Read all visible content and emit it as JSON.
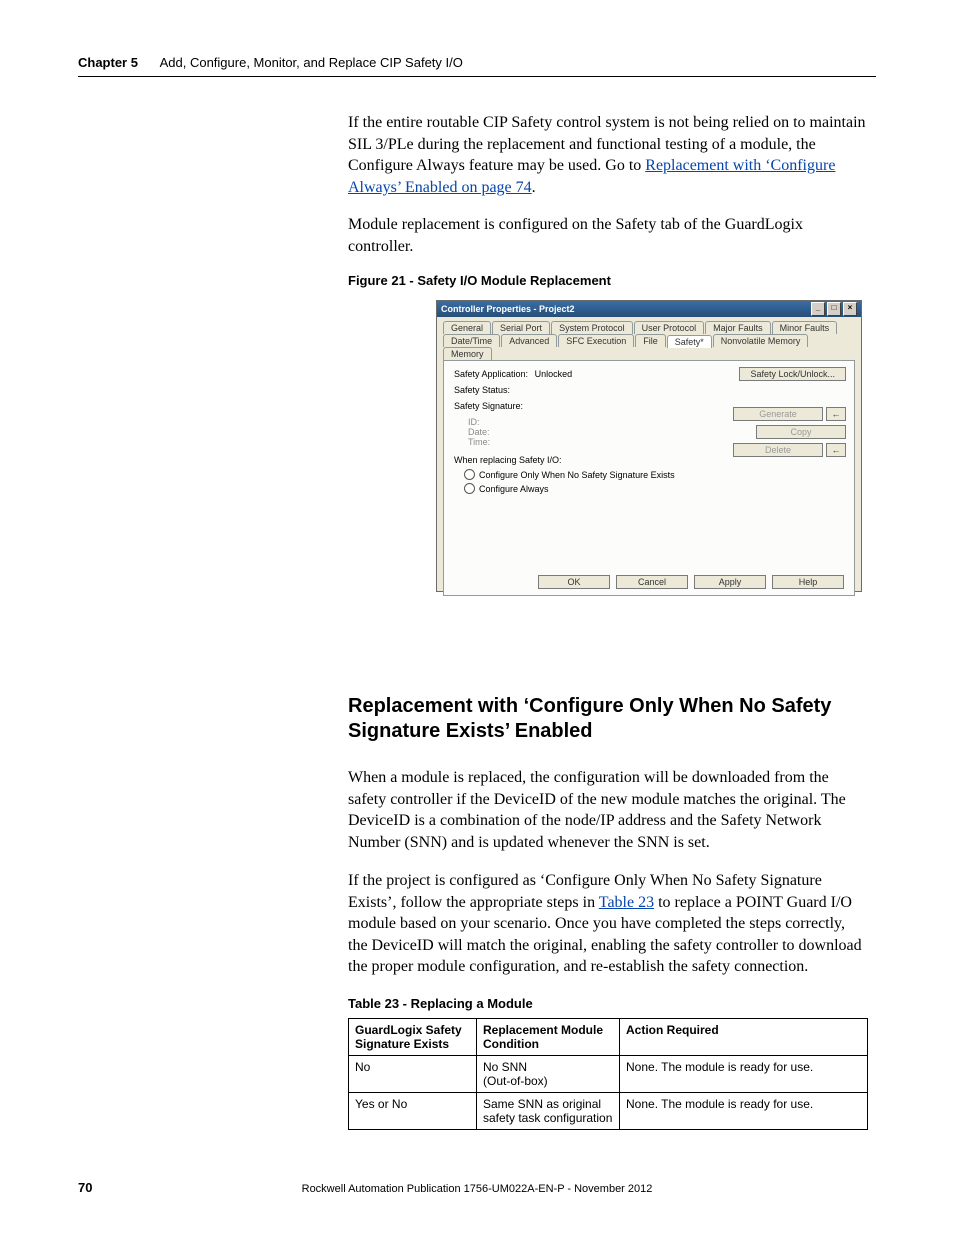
{
  "header": {
    "chapter": "Chapter 5",
    "title": "Add, Configure, Monitor, and Replace CIP Safety I/O"
  },
  "para1_a": "If the entire routable CIP Safety control system is not being relied on to maintain SIL 3/PLe during the replacement and functional testing of a module, the Configure Always feature may be used. Go to ",
  "para1_link": "Replacement with ‘Configure Always’ Enabled on page 74",
  "para1_b": ".",
  "para2": "Module replacement is configured on the Safety tab of the GuardLogix controller.",
  "figure_caption": "Figure 21 - Safety I/O Module Replacement",
  "dialog": {
    "title": "Controller Properties - Project2",
    "tabs_row1": [
      "General",
      "Serial Port",
      "System Protocol",
      "User Protocol",
      "Major Faults",
      "Minor Faults"
    ],
    "tabs_row2": [
      "Date/Time",
      "Advanced",
      "SFC Execution",
      "File",
      "Safety*",
      "Nonvolatile Memory",
      "Memory"
    ],
    "safety_app_label": "Safety Application:",
    "safety_app_value": "Unlocked",
    "safety_status_label": "Safety Status:",
    "safety_sig_label": "Safety Signature:",
    "sig_id": "ID:",
    "sig_date": "Date:",
    "sig_time": "Time:",
    "when_label": "When replacing Safety I/O:",
    "opt1": "Configure Only When No Safety Signature Exists",
    "opt2": "Configure Always",
    "btn_lock": "Safety Lock/Unlock...",
    "btn_gen": "Generate",
    "btn_copy": "Copy",
    "btn_del": "Delete",
    "btn_ok": "OK",
    "btn_cancel": "Cancel",
    "btn_apply": "Apply",
    "btn_help": "Help"
  },
  "section_heading": "Replacement with ‘Configure Only When No Safety Signature Exists’ Enabled",
  "para3": "When a module is replaced, the configuration will be downloaded from the safety controller if the DeviceID of the new module matches the original. The DeviceID is a combination of the node/IP address and the Safety Network Number (SNN) and is updated whenever the SNN is set.",
  "para4_a": "If the project is configured as ‘Configure Only When No Safety Signature Exists’, follow the appropriate steps in ",
  "para4_link": "Table 23",
  "para4_b": " to replace a POINT Guard I/O module based on your scenario. Once you have completed the steps correctly, the DeviceID will match the original, enabling the safety controller to download the proper module configuration, and re-establish the safety connection.",
  "table_caption": "Table 23 - Replacing a Module",
  "table": {
    "headers": [
      "GuardLogix Safety Signature Exists",
      "Replacement Module Condition",
      "Action Required"
    ],
    "rows": [
      [
        "No",
        "No SNN\n(Out-of-box)",
        "None. The module is ready for use."
      ],
      [
        "Yes or No",
        "Same SNN as original safety task configuration",
        "None. The module is ready for use."
      ]
    ]
  },
  "page_number": "70",
  "pub_id": "Rockwell Automation Publication 1756-UM022A-EN-P - November 2012"
}
